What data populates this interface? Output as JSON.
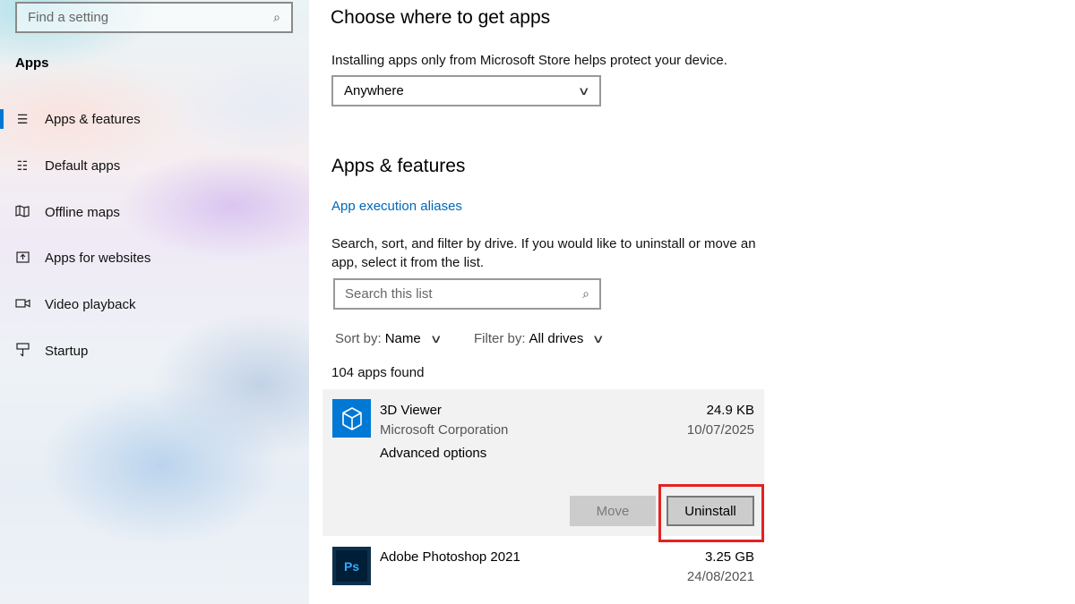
{
  "sidebar": {
    "search_placeholder": "Find a setting",
    "heading": "Apps",
    "items": [
      {
        "label": "Apps & features",
        "icon": "list-icon",
        "active": true
      },
      {
        "label": "Default apps",
        "icon": "default-apps-icon",
        "active": false
      },
      {
        "label": "Offline maps",
        "icon": "map-icon",
        "active": false
      },
      {
        "label": "Apps for websites",
        "icon": "open-website-icon",
        "active": false
      },
      {
        "label": "Video playback",
        "icon": "video-icon",
        "active": false
      },
      {
        "label": "Startup",
        "icon": "startup-icon",
        "active": false
      }
    ]
  },
  "choose_section": {
    "title": "Choose where to get apps",
    "description": "Installing apps only from Microsoft Store helps protect your device.",
    "dropdown_value": "Anywhere"
  },
  "apps_section": {
    "title": "Apps & features",
    "alias_link": "App execution aliases",
    "description_line1": "Search, sort, and filter by drive. If you would like to uninstall or move an",
    "description_line2": "app, select it from the list.",
    "search_placeholder": "Search this list",
    "sort_label": "Sort by:",
    "sort_value": "Name",
    "filter_label": "Filter by:",
    "filter_value": "All drives",
    "count_text": "104 apps found"
  },
  "apps": [
    {
      "name": "3D Viewer",
      "publisher": "Microsoft Corporation",
      "size": "24.9 KB",
      "date": "10/07/2025",
      "advanced_label": "Advanced options",
      "move_label": "Move",
      "uninstall_label": "Uninstall",
      "icon": "3d-cube-icon",
      "icon_color": "#0078d4"
    },
    {
      "name": "Adobe Photoshop 2021",
      "size": "3.25 GB",
      "date": "24/08/2021",
      "icon": "photoshop-icon",
      "icon_text": "Ps",
      "icon_color": "#0e2f4a",
      "icon_text_color": "#31a8ff"
    }
  ],
  "colors": {
    "accent": "#0078d4",
    "link": "#0067b8",
    "highlight": "#e32222"
  }
}
